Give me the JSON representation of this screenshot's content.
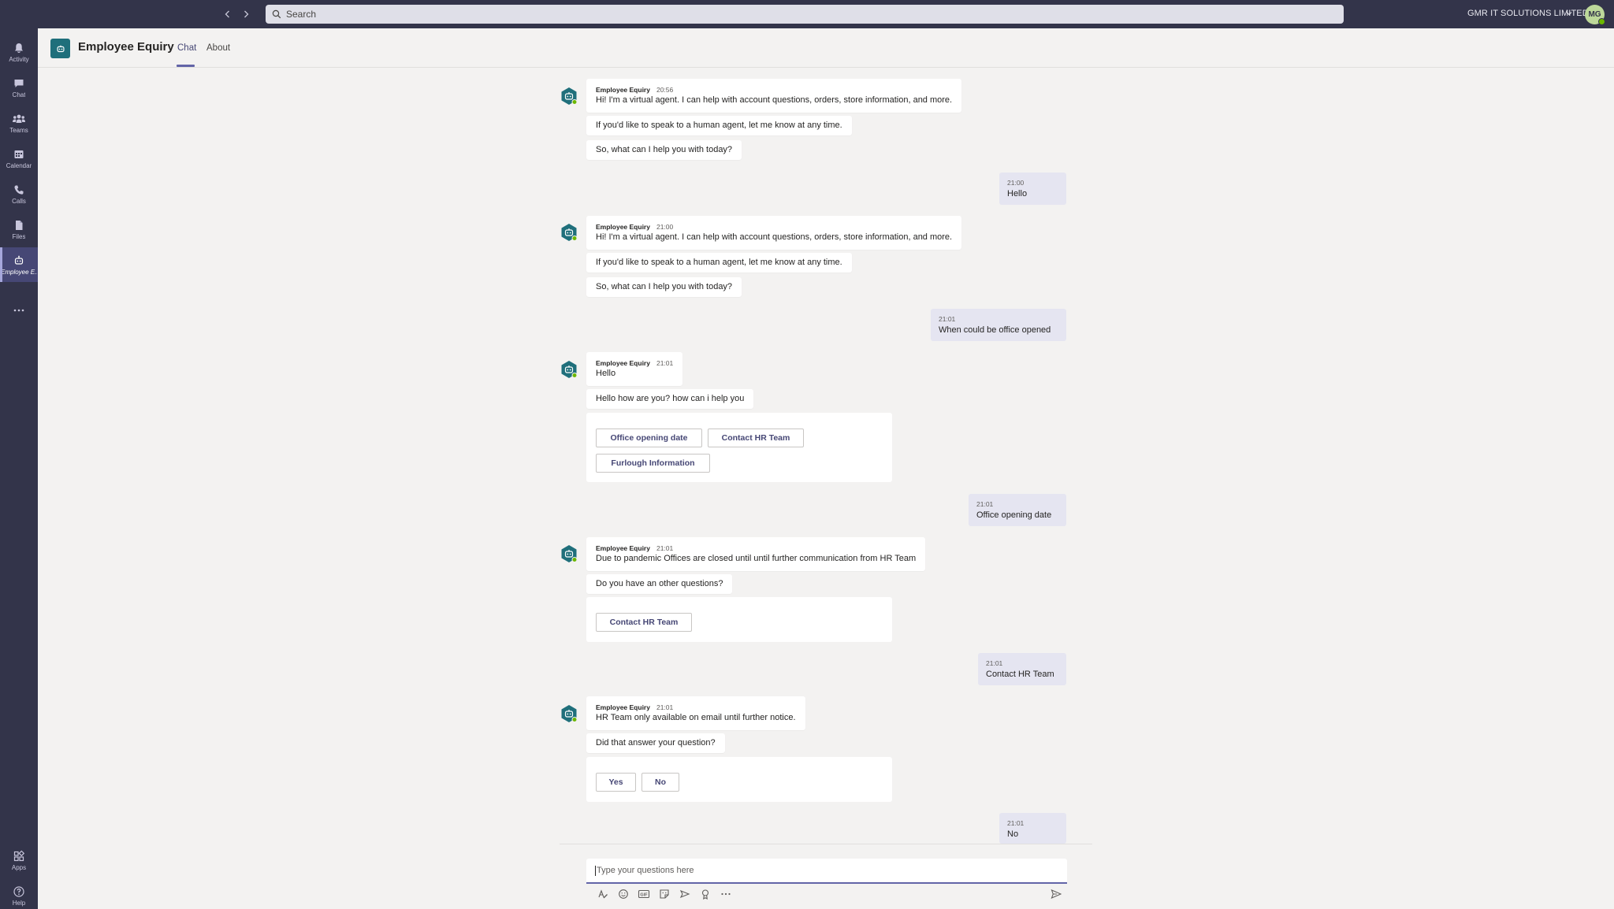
{
  "topbar": {
    "search_placeholder": "Search",
    "org_name": "GMR IT SOLUTIONS LIMITED",
    "avatar_initials": "MG"
  },
  "rail": {
    "items": [
      {
        "label": "Activity",
        "icon": "bell-icon"
      },
      {
        "label": "Chat",
        "icon": "chat-icon"
      },
      {
        "label": "Teams",
        "icon": "teams-icon"
      },
      {
        "label": "Calendar",
        "icon": "calendar-icon"
      },
      {
        "label": "Calls",
        "icon": "phone-icon"
      },
      {
        "label": "Files",
        "icon": "files-icon"
      },
      {
        "label": "Employee E...",
        "icon": "bot-icon",
        "active": true
      }
    ],
    "more_label": "...",
    "apps_label": "Apps",
    "help_label": "Help"
  },
  "header": {
    "title": "Employee Equiry",
    "tabs": [
      {
        "label": "Chat",
        "active": true
      },
      {
        "label": "About"
      }
    ]
  },
  "messages": {
    "m1": {
      "sender": "Employee Equiry",
      "time": "20:56",
      "text": "Hi! I'm a virtual agent. I can help with account questions, orders, store information, and more."
    },
    "m1b": {
      "text": "If you'd like to speak to a human agent, let me know at any time."
    },
    "m1c": {
      "text": "So, what can I help you with today?"
    },
    "u1": {
      "time": "21:00",
      "text": "Hello"
    },
    "m2": {
      "sender": "Employee Equiry",
      "time": "21:00",
      "text": "Hi! I'm a virtual agent. I can help with account questions, orders, store information, and more."
    },
    "m2b": {
      "text": "If you'd like to speak to a human agent, let me know at any time."
    },
    "m2c": {
      "text": "So, what can I help you with today?"
    },
    "u2": {
      "time": "21:01",
      "text": "When could be office opened"
    },
    "m3": {
      "sender": "Employee Equiry",
      "time": "21:01",
      "text": "Hello"
    },
    "m3b": {
      "text": "Hello how are you? how can i help you"
    },
    "m3card": {
      "buttons": [
        "Office opening date",
        "Contact HR Team",
        "Furlough Information"
      ]
    },
    "u3": {
      "time": "21:01",
      "text": "Office opening date"
    },
    "m4": {
      "sender": "Employee Equiry",
      "time": "21:01",
      "text": "Due to pandemic Offices are closed until until further communication from HR Team"
    },
    "m4b": {
      "text": "Do you have an other questions?"
    },
    "m4card": {
      "buttons": [
        "Contact HR Team"
      ]
    },
    "u4": {
      "time": "21:01",
      "text": "Contact HR Team"
    },
    "m5": {
      "sender": "Employee Equiry",
      "time": "21:01",
      "text": "HR Team only available on email until further notice."
    },
    "m5b": {
      "text": "Did that answer your question?"
    },
    "m5card": {
      "buttons": [
        "Yes",
        "No"
      ]
    },
    "u5": {
      "time": "21:01",
      "text": "No"
    }
  },
  "compose": {
    "placeholder": "Type your questions here",
    "toolbar_icons": [
      "format-icon",
      "emoji-icon",
      "gif-icon",
      "sticker-icon",
      "meet-icon",
      "praise-icon",
      "more-icon"
    ]
  },
  "colors": {
    "accent": "#6264a7",
    "rail": "#33344a",
    "bot": "#1f6f7b",
    "presence": "#6bb700"
  }
}
